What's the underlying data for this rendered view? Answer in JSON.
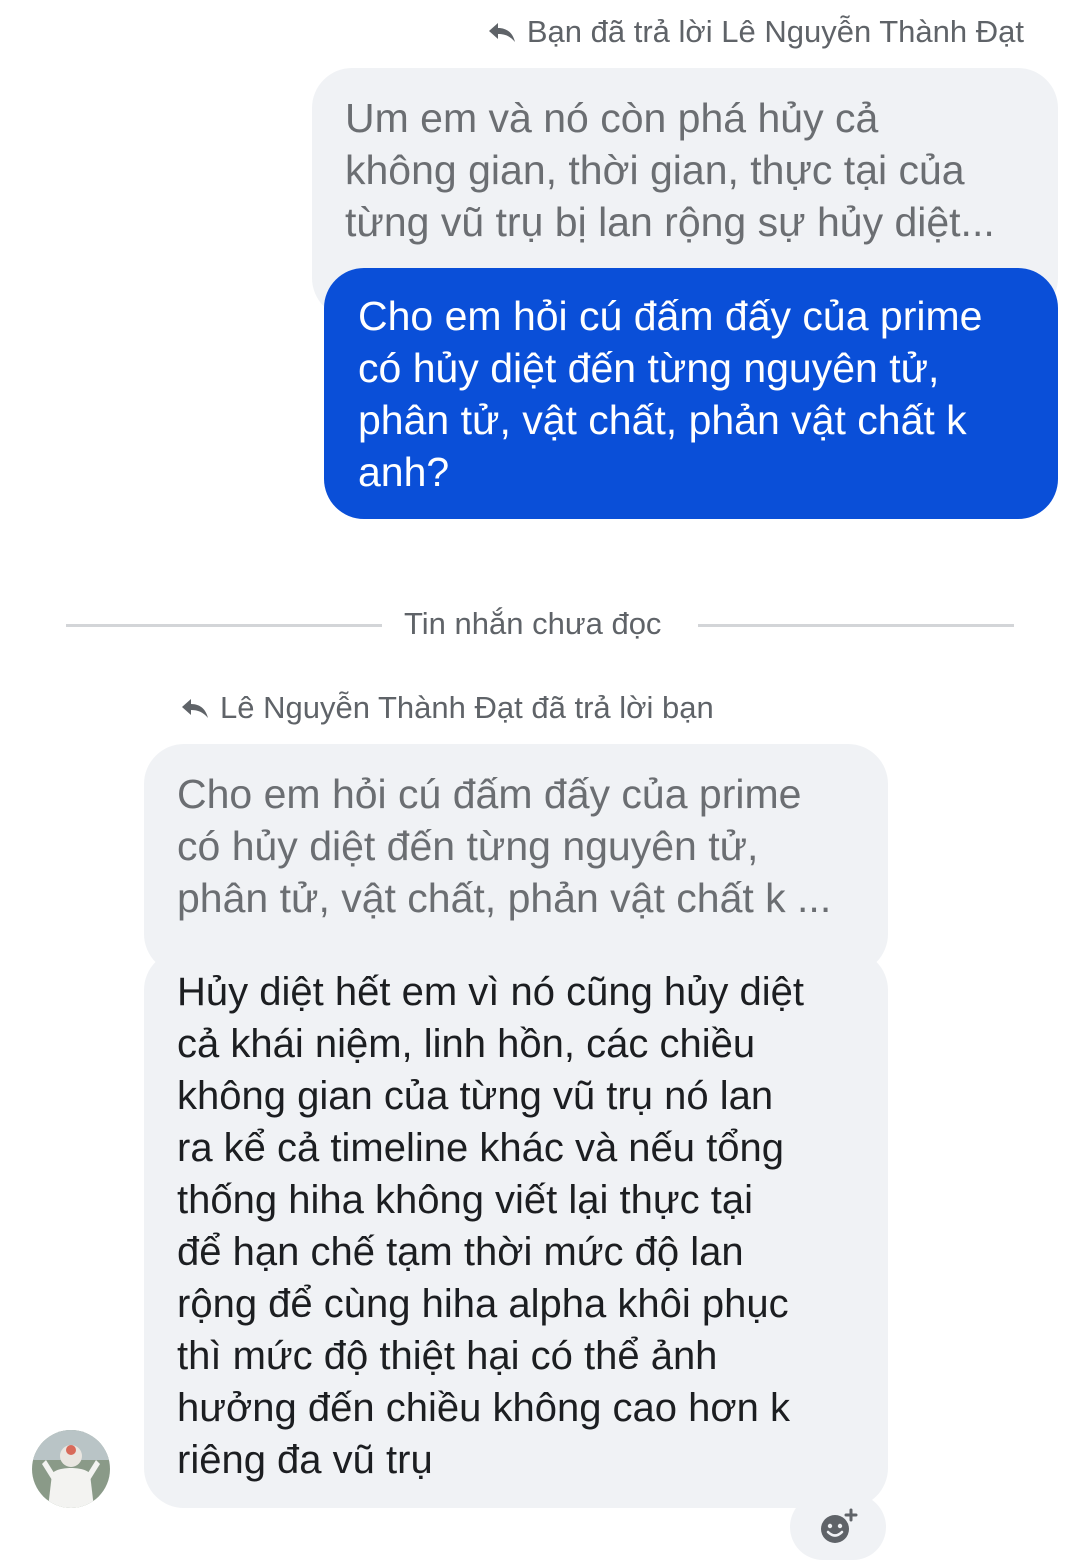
{
  "thread": {
    "outgoing": {
      "reply_label": "Bạn đã trả lời Lê Nguyễn Thành Đạt",
      "quoted_lines": [
        "Um em và nó còn phá hủy cả",
        "không gian, thời gian, thực tại của",
        "từng vũ trụ bị lan rộng sự hủy diệt..."
      ],
      "message_lines": [
        "Cho em hỏi cú đấm đấy của prime",
        "có hủy diệt đến từng nguyên tử,",
        "phân tử, vật chất, phản vật chất k",
        "anh?"
      ]
    },
    "divider": {
      "label": "Tin nhắn chưa đọc"
    },
    "incoming": {
      "reply_label": "Lê Nguyễn Thành Đạt đã trả lời bạn",
      "quoted_lines": [
        "Cho em hỏi cú đấm đấy của prime",
        "có hủy diệt đến từng nguyên tử,",
        "phân tử, vật chất, phản vật chất k ..."
      ],
      "message_lines": [
        "Hủy diệt hết em vì nó cũng hủy diệt",
        "cả khái niệm, linh hồn, các chiều",
        "không gian của từng vũ trụ nó lan",
        "ra kể cả timeline khác và nếu tổng",
        "thống hiha không viết lại thực tại",
        "để hạn chế tạm thời mức độ lan",
        "rộng để cùng hiha alpha khôi phục",
        "thì mức độ thiệt hại có thể ảnh",
        "hưởng đến chiều không cao hơn k",
        "riêng đa vũ trụ"
      ]
    }
  },
  "icons": {
    "reply": "reply-arrow-icon",
    "reaction": "add-reaction-icon",
    "avatar": "user-avatar"
  },
  "colors": {
    "sent_bubble": "#0a4fd8",
    "received_bubble": "#f0f2f5",
    "secondary_text": "#5f6368"
  }
}
